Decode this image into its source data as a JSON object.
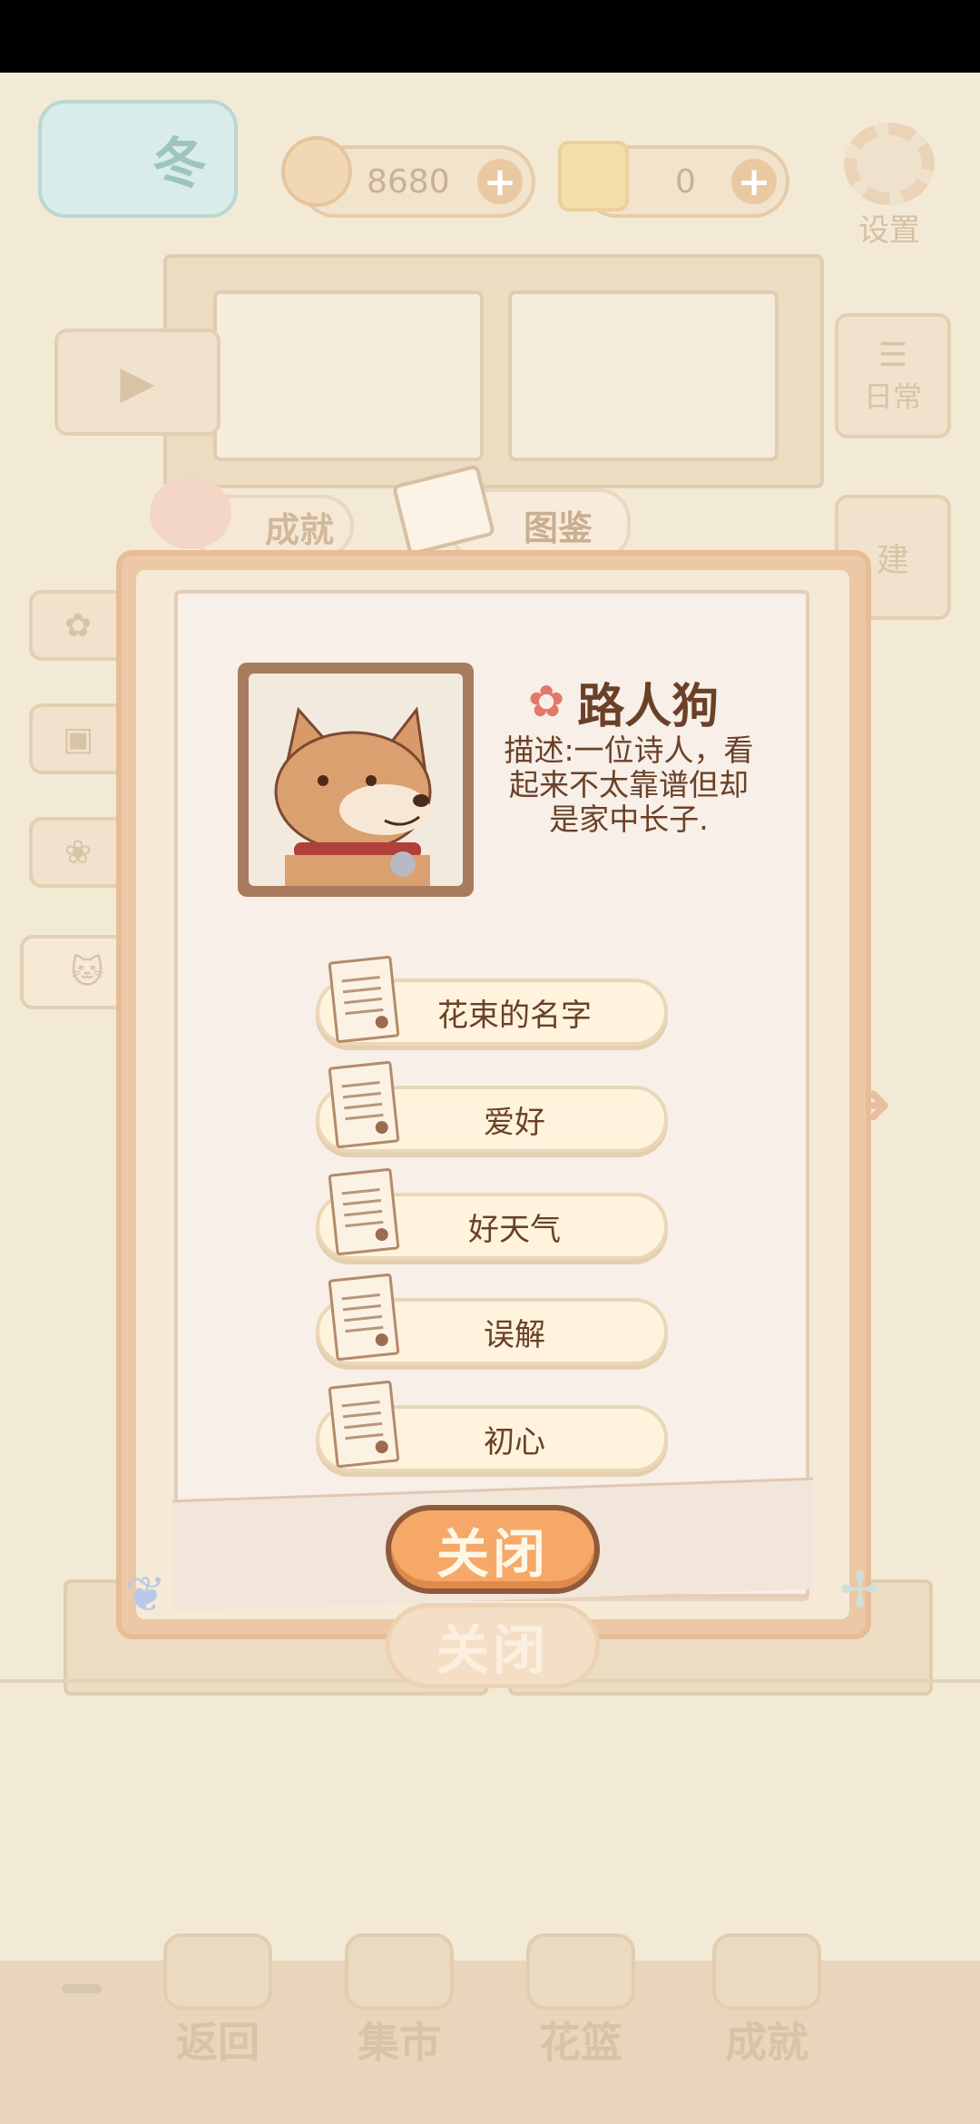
{
  "hud": {
    "season_label": "冬",
    "fish_count": "8680",
    "cheese_count": "0",
    "settings_label": "设置",
    "daily_label": "日常",
    "build_label": "建"
  },
  "tabs": {
    "achievement": "成就",
    "collection": "图鉴"
  },
  "card": {
    "name": "路人狗",
    "description": "描述:一位诗人，看起来不太靠谱但却是家中长子."
  },
  "stories": [
    {
      "label": "花束的名字"
    },
    {
      "label": "爱好"
    },
    {
      "label": "好天气"
    },
    {
      "label": "误解"
    },
    {
      "label": "初心"
    }
  ],
  "close_label": "关闭",
  "close_ghost_label": "关闭",
  "nav": {
    "back": "返回",
    "market": "集市",
    "basket": "花篮",
    "achievement": "成就"
  },
  "colors": {
    "frame": "#ecc8a7",
    "paper": "#f7efe8",
    "close_button": "#f5a868",
    "text_brown": "#6a4128"
  }
}
